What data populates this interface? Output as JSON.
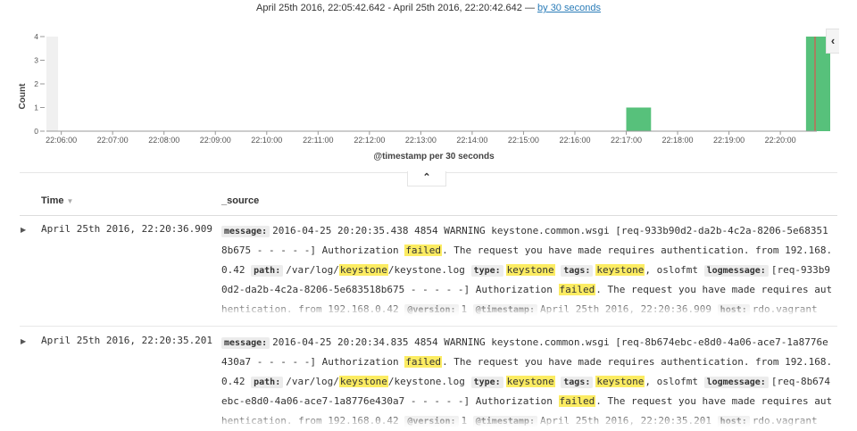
{
  "range": {
    "text": "April 25th 2016, 22:05:42.642 - April 25th 2016, 22:20:42.642 —",
    "interval_link": "by 30 seconds"
  },
  "chart_data": {
    "type": "bar",
    "ylabel": "Count",
    "xlabel": "@timestamp per 30 seconds",
    "y_ticks": [
      0,
      1,
      2,
      3,
      4
    ],
    "ylim": [
      0,
      4
    ],
    "x_ticks": [
      "22:06:00",
      "22:07:00",
      "22:08:00",
      "22:09:00",
      "22:10:00",
      "22:11:00",
      "22:12:00",
      "22:13:00",
      "22:14:00",
      "22:15:00",
      "22:16:00",
      "22:17:00",
      "22:18:00",
      "22:19:00",
      "22:20:00"
    ],
    "x_start": "22:05:42.642",
    "x_end": "22:20:42.642",
    "bars": [
      {
        "time": "22:17:00",
        "count": 1
      },
      {
        "time": "22:20:30",
        "count": 4
      }
    ],
    "bar_color": "#57c17b"
  },
  "controls": {
    "collapse_side": "‹",
    "toggle_chart": "⌃"
  },
  "table": {
    "headers": {
      "time": "Time",
      "source": "_source"
    },
    "rows": [
      {
        "time": "April 25th 2016, 22:20:36.909",
        "source": [
          {
            "key": "message:",
            "parts": [
              {
                "t": "2016-04-25 20:20:35.438 4854 WARNING keystone.common.wsgi [req-933b90d2-da2b-4c2a-8206-5e683518b675 - - - - -] Authorization "
              },
              {
                "t": "failed",
                "hl": true
              },
              {
                "t": ". The request you have made requires authentication. from 192.168.0.42"
              }
            ]
          },
          {
            "key": "path:",
            "parts": [
              {
                "t": "/var/log/"
              },
              {
                "t": "keystone",
                "hl": true
              },
              {
                "t": "/keystone.log"
              }
            ]
          },
          {
            "key": "type:",
            "parts": [
              {
                "t": "keystone",
                "hl": true
              }
            ]
          },
          {
            "key": "tags:",
            "parts": [
              {
                "t": "keystone",
                "hl": true
              },
              {
                "t": ", oslofmt"
              }
            ]
          },
          {
            "key": "logmessage:",
            "parts": [
              {
                "t": "[req-933b90d2-da2b-4c2a-8206-5e683518b675 - - - - -] Authorization "
              },
              {
                "t": "failed",
                "hl": true
              },
              {
                "t": ". The request you have made requires authentication. from 192.168.0.42"
              }
            ]
          },
          {
            "key": "@version:",
            "parts": [
              {
                "t": "1"
              }
            ]
          },
          {
            "key": "@timestamp:",
            "parts": [
              {
                "t": "April 25th 2016, 22:20:36.909"
              }
            ]
          },
          {
            "key": "host:",
            "parts": [
              {
                "t": "rdo.vagrant"
              }
            ]
          }
        ]
      },
      {
        "time": "April 25th 2016, 22:20:35.201",
        "source": [
          {
            "key": "message:",
            "parts": [
              {
                "t": "2016-04-25 20:20:34.835 4854 WARNING keystone.common.wsgi [req-8b674ebc-e8d0-4a06-ace7-1a8776e430a7 - - - - -] Authorization "
              },
              {
                "t": "failed",
                "hl": true
              },
              {
                "t": ". The request you have made requires authentication. from 192.168.0.42"
              }
            ]
          },
          {
            "key": "path:",
            "parts": [
              {
                "t": "/var/log/"
              },
              {
                "t": "keystone",
                "hl": true
              },
              {
                "t": "/keystone.log"
              }
            ]
          },
          {
            "key": "type:",
            "parts": [
              {
                "t": "keystone",
                "hl": true
              }
            ]
          },
          {
            "key": "tags:",
            "parts": [
              {
                "t": "keystone",
                "hl": true
              },
              {
                "t": ", oslofmt"
              }
            ]
          },
          {
            "key": "logmessage:",
            "parts": [
              {
                "t": "[req-8b674ebc-e8d0-4a06-ace7-1a8776e430a7 - - - - -] Authorization "
              },
              {
                "t": "failed",
                "hl": true
              },
              {
                "t": ". The request you have made requires authentication. from 192.168.0.42"
              }
            ]
          },
          {
            "key": "@version:",
            "parts": [
              {
                "t": "1"
              }
            ]
          },
          {
            "key": "@timestamp:",
            "parts": [
              {
                "t": "April 25th 2016, 22:20:35.201"
              }
            ]
          },
          {
            "key": "host:",
            "parts": [
              {
                "t": "rdo.vagrant"
              }
            ]
          }
        ]
      }
    ]
  }
}
